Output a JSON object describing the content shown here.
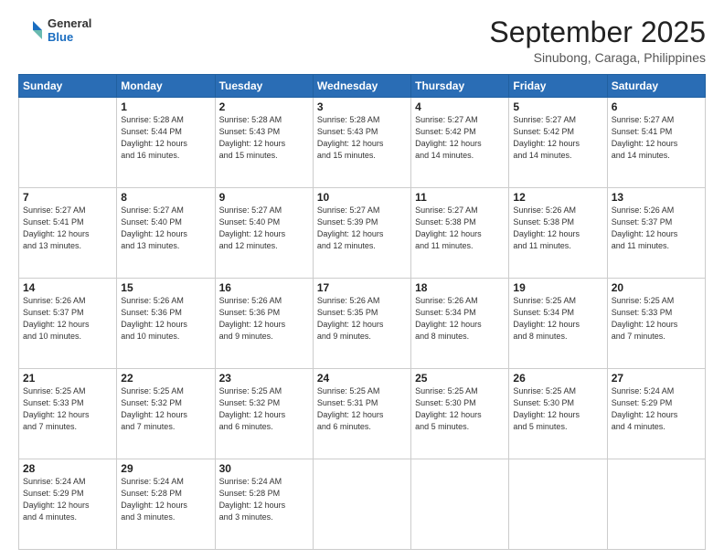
{
  "header": {
    "logo_general": "General",
    "logo_blue": "Blue",
    "month_title": "September 2025",
    "location": "Sinubong, Caraga, Philippines"
  },
  "calendar": {
    "days_of_week": [
      "Sunday",
      "Monday",
      "Tuesday",
      "Wednesday",
      "Thursday",
      "Friday",
      "Saturday"
    ],
    "weeks": [
      [
        {
          "day": "",
          "info": ""
        },
        {
          "day": "1",
          "info": "Sunrise: 5:28 AM\nSunset: 5:44 PM\nDaylight: 12 hours\nand 16 minutes."
        },
        {
          "day": "2",
          "info": "Sunrise: 5:28 AM\nSunset: 5:43 PM\nDaylight: 12 hours\nand 15 minutes."
        },
        {
          "day": "3",
          "info": "Sunrise: 5:28 AM\nSunset: 5:43 PM\nDaylight: 12 hours\nand 15 minutes."
        },
        {
          "day": "4",
          "info": "Sunrise: 5:27 AM\nSunset: 5:42 PM\nDaylight: 12 hours\nand 14 minutes."
        },
        {
          "day": "5",
          "info": "Sunrise: 5:27 AM\nSunset: 5:42 PM\nDaylight: 12 hours\nand 14 minutes."
        },
        {
          "day": "6",
          "info": "Sunrise: 5:27 AM\nSunset: 5:41 PM\nDaylight: 12 hours\nand 14 minutes."
        }
      ],
      [
        {
          "day": "7",
          "info": "Sunrise: 5:27 AM\nSunset: 5:41 PM\nDaylight: 12 hours\nand 13 minutes."
        },
        {
          "day": "8",
          "info": "Sunrise: 5:27 AM\nSunset: 5:40 PM\nDaylight: 12 hours\nand 13 minutes."
        },
        {
          "day": "9",
          "info": "Sunrise: 5:27 AM\nSunset: 5:40 PM\nDaylight: 12 hours\nand 12 minutes."
        },
        {
          "day": "10",
          "info": "Sunrise: 5:27 AM\nSunset: 5:39 PM\nDaylight: 12 hours\nand 12 minutes."
        },
        {
          "day": "11",
          "info": "Sunrise: 5:27 AM\nSunset: 5:38 PM\nDaylight: 12 hours\nand 11 minutes."
        },
        {
          "day": "12",
          "info": "Sunrise: 5:26 AM\nSunset: 5:38 PM\nDaylight: 12 hours\nand 11 minutes."
        },
        {
          "day": "13",
          "info": "Sunrise: 5:26 AM\nSunset: 5:37 PM\nDaylight: 12 hours\nand 11 minutes."
        }
      ],
      [
        {
          "day": "14",
          "info": "Sunrise: 5:26 AM\nSunset: 5:37 PM\nDaylight: 12 hours\nand 10 minutes."
        },
        {
          "day": "15",
          "info": "Sunrise: 5:26 AM\nSunset: 5:36 PM\nDaylight: 12 hours\nand 10 minutes."
        },
        {
          "day": "16",
          "info": "Sunrise: 5:26 AM\nSunset: 5:36 PM\nDaylight: 12 hours\nand 9 minutes."
        },
        {
          "day": "17",
          "info": "Sunrise: 5:26 AM\nSunset: 5:35 PM\nDaylight: 12 hours\nand 9 minutes."
        },
        {
          "day": "18",
          "info": "Sunrise: 5:26 AM\nSunset: 5:34 PM\nDaylight: 12 hours\nand 8 minutes."
        },
        {
          "day": "19",
          "info": "Sunrise: 5:25 AM\nSunset: 5:34 PM\nDaylight: 12 hours\nand 8 minutes."
        },
        {
          "day": "20",
          "info": "Sunrise: 5:25 AM\nSunset: 5:33 PM\nDaylight: 12 hours\nand 7 minutes."
        }
      ],
      [
        {
          "day": "21",
          "info": "Sunrise: 5:25 AM\nSunset: 5:33 PM\nDaylight: 12 hours\nand 7 minutes."
        },
        {
          "day": "22",
          "info": "Sunrise: 5:25 AM\nSunset: 5:32 PM\nDaylight: 12 hours\nand 7 minutes."
        },
        {
          "day": "23",
          "info": "Sunrise: 5:25 AM\nSunset: 5:32 PM\nDaylight: 12 hours\nand 6 minutes."
        },
        {
          "day": "24",
          "info": "Sunrise: 5:25 AM\nSunset: 5:31 PM\nDaylight: 12 hours\nand 6 minutes."
        },
        {
          "day": "25",
          "info": "Sunrise: 5:25 AM\nSunset: 5:30 PM\nDaylight: 12 hours\nand 5 minutes."
        },
        {
          "day": "26",
          "info": "Sunrise: 5:25 AM\nSunset: 5:30 PM\nDaylight: 12 hours\nand 5 minutes."
        },
        {
          "day": "27",
          "info": "Sunrise: 5:24 AM\nSunset: 5:29 PM\nDaylight: 12 hours\nand 4 minutes."
        }
      ],
      [
        {
          "day": "28",
          "info": "Sunrise: 5:24 AM\nSunset: 5:29 PM\nDaylight: 12 hours\nand 4 minutes."
        },
        {
          "day": "29",
          "info": "Sunrise: 5:24 AM\nSunset: 5:28 PM\nDaylight: 12 hours\nand 3 minutes."
        },
        {
          "day": "30",
          "info": "Sunrise: 5:24 AM\nSunset: 5:28 PM\nDaylight: 12 hours\nand 3 minutes."
        },
        {
          "day": "",
          "info": ""
        },
        {
          "day": "",
          "info": ""
        },
        {
          "day": "",
          "info": ""
        },
        {
          "day": "",
          "info": ""
        }
      ]
    ]
  }
}
